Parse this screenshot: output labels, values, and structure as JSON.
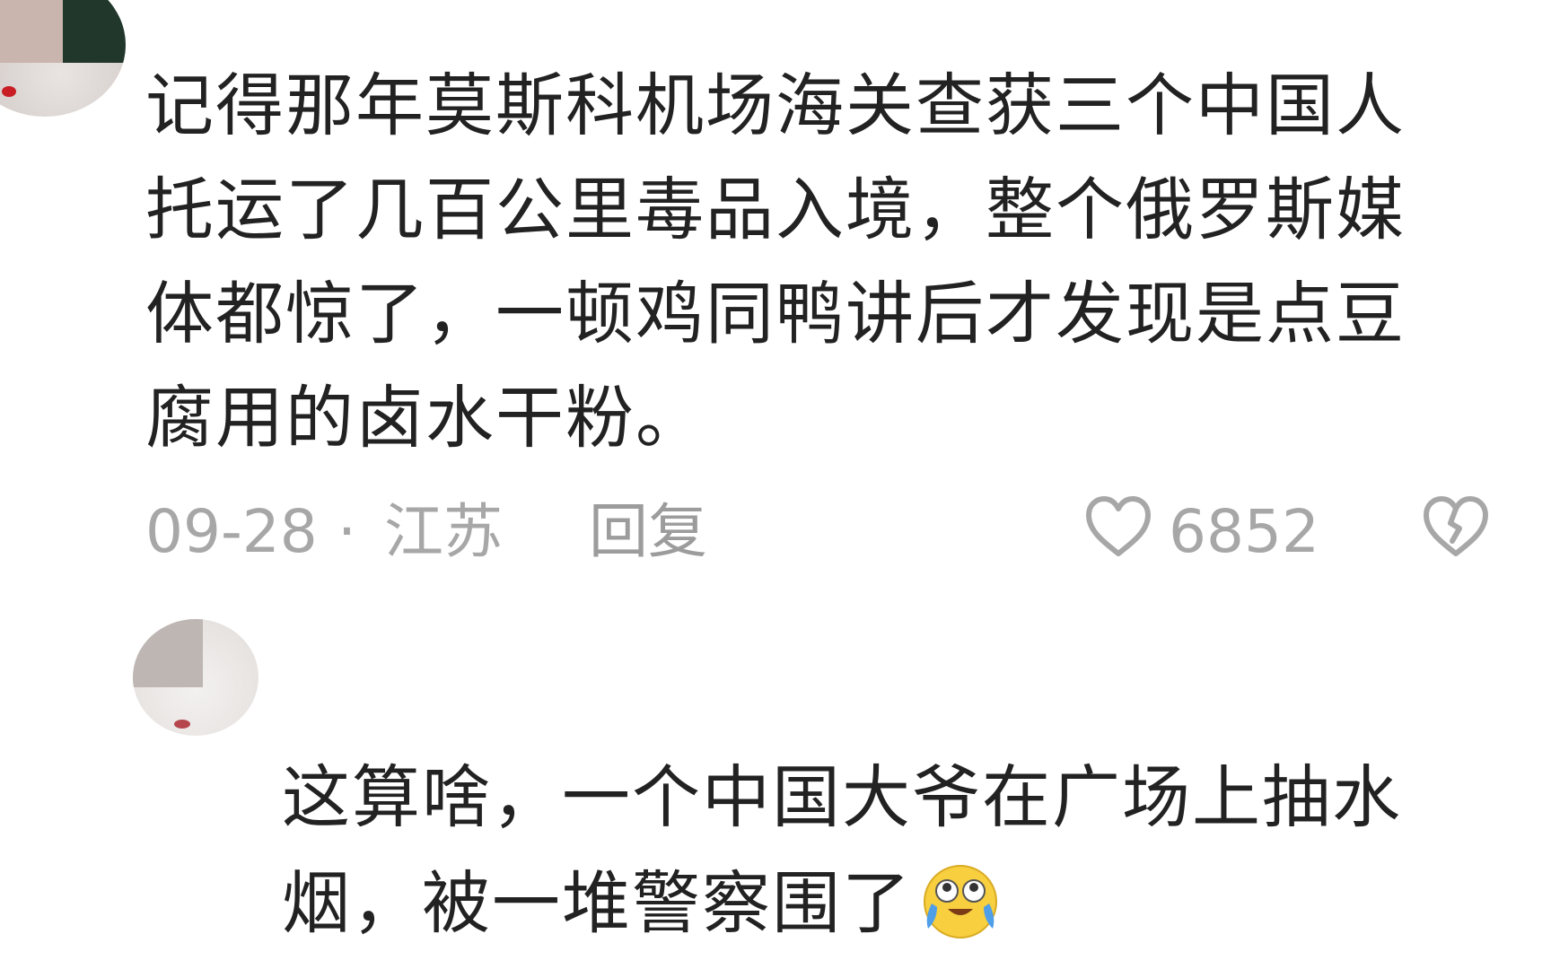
{
  "comments": [
    {
      "text": "记得那年莫斯科机场海关查获三个中国人托运了几百公里毒品入境，整个俄罗斯媒体都惊了，一顿鸡同鸭讲后才发现是点豆腐用的卤水干粉。",
      "date": "09-28",
      "separator": "·",
      "region": "江苏",
      "reply_label": "回复",
      "likes": "6852"
    },
    {
      "text": "这算啥，一个中国大爷在广场上抽水烟，被一堆警察围了",
      "emoji": "crying-laughing-emoji"
    }
  ],
  "colors": {
    "text": "#222222",
    "meta": "#a7a7a7",
    "emoji_face": "#f7cf3f",
    "emoji_tears": "#4f9ee8"
  }
}
